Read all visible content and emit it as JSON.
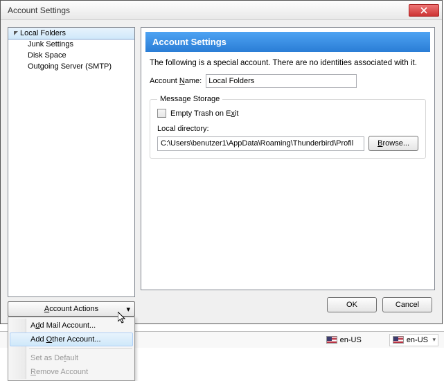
{
  "window": {
    "title": "Account Settings"
  },
  "tree": {
    "root": "Local Folders",
    "children": [
      "Junk Settings",
      "Disk Space",
      "Outgoing Server (SMTP)"
    ]
  },
  "actions_btn": {
    "label": "Account Actions",
    "accel": "A"
  },
  "menu": {
    "add_mail": {
      "label": "Add Mail Account...",
      "accel": "d"
    },
    "add_other": {
      "label": "Add Other Account...",
      "accel": "O"
    },
    "set_default": {
      "label": "Set as Default",
      "accel": "f"
    },
    "remove": {
      "label": "Remove Account",
      "accel": "R"
    }
  },
  "panel": {
    "header": "Account Settings",
    "description": "The following is a special account. There are no identities associated with it.",
    "account_name_label": {
      "pre": "Account ",
      "accel": "N",
      "post": "ame:"
    },
    "account_name_value": "Local Folders",
    "storage_legend": "Message Storage",
    "empty_trash": {
      "pre": "Empty Trash on E",
      "accel": "x",
      "post": "it"
    },
    "local_dir_label": "Local directory:",
    "local_dir_value": "C:\\Users\\benutzer1\\AppData\\Roaming\\Thunderbird\\Profil",
    "browse": {
      "label": "Browse...",
      "accel": "B"
    },
    "ok": "OK",
    "cancel": "Cancel"
  },
  "langbar": {
    "lang": "en-US"
  }
}
